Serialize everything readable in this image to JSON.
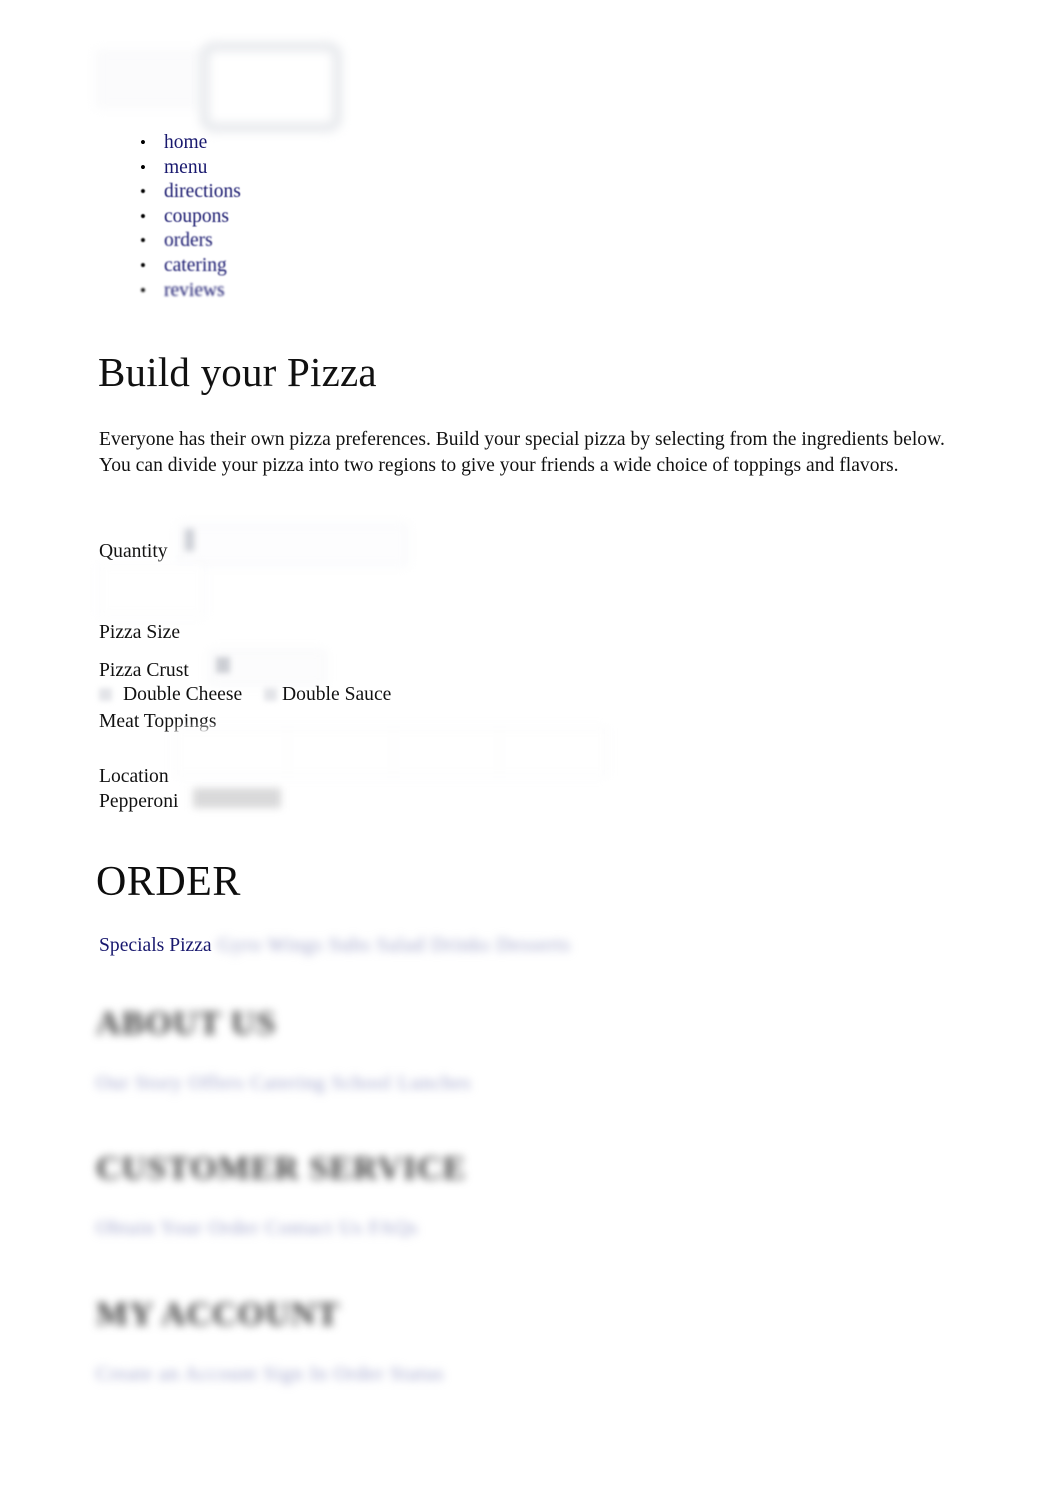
{
  "header": {
    "logo_placeholder": "pizza-logo-image",
    "badge_placeholder": "cart-badge"
  },
  "nav": {
    "items": [
      {
        "label": "home"
      },
      {
        "label": "menu"
      },
      {
        "label": "directions"
      },
      {
        "label": "coupons"
      },
      {
        "label": "orders"
      },
      {
        "label": "catering"
      },
      {
        "label": "reviews"
      }
    ]
  },
  "main": {
    "heading": "Build your Pizza",
    "intro": "Everyone has their own pizza preferences. Build your special pizza by selecting from the ingredients below. You can divide your pizza into two regions to give your friends a wide choice of toppings and flavors.",
    "form": {
      "quantity_label": "Quantity",
      "quantity_value": "1",
      "size_label": "Pizza Size",
      "size_value": "",
      "crust_label": "Pizza Crust",
      "crust_value": "",
      "double_cheese_label": "Double Cheese",
      "double_sauce_label": "Double Sauce",
      "meat_toppings_label": "Meat Toppings",
      "location_label": "Location",
      "pepperoni_label": "Pepperoni",
      "pepperoni_value": "",
      "topping_columns": [
        "",
        "",
        "",
        ""
      ]
    },
    "order_heading": "ORDER"
  },
  "specials": {
    "label": "Specials Pizza",
    "links": "Gyro Wings Subs Salad Drinks Desserts"
  },
  "footer": {
    "sections": [
      {
        "title": "ABOUT US",
        "links": "Our Story Offers Catering School Lunches"
      },
      {
        "title": "CUSTOMER SERVICE",
        "links": "Obtain Your Order Contact Us FAQs"
      },
      {
        "title": "MY ACCOUNT",
        "links": "Create an Account Sign In Order Status"
      }
    ]
  },
  "colors": {
    "link": "#18186e",
    "visited_link": "#9ea2ca",
    "text": "#111111",
    "background": "#ffffff"
  }
}
